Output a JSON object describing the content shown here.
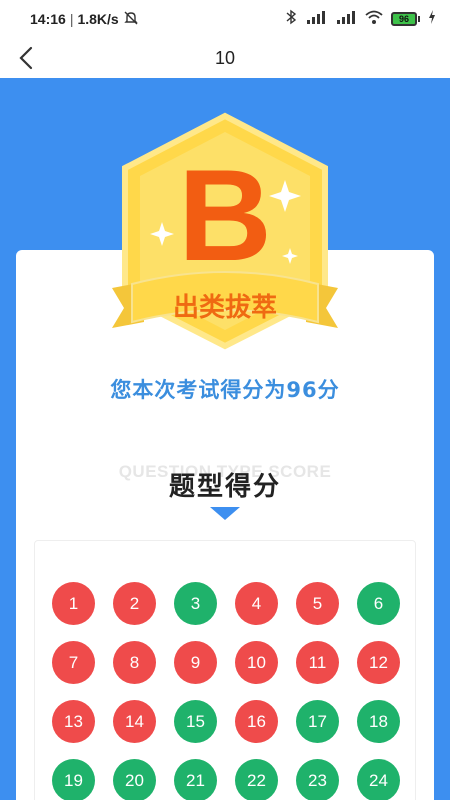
{
  "status_bar": {
    "time": "14:16",
    "net_speed": "1.8K/s",
    "battery": "96"
  },
  "nav": {
    "title": "10"
  },
  "badge": {
    "grade": "B",
    "ribbon_text": "出类拔萃"
  },
  "result": {
    "score_text": "您本次考试得分为96分"
  },
  "section": {
    "title_en": "QUESTION TYPE SCORE",
    "title_cn": "题型得分"
  },
  "colors": {
    "correct": "#1fb26b",
    "wrong": "#ef4b4b",
    "accent": "#3d8ff0"
  },
  "questions": [
    {
      "n": "1",
      "status": "wrong"
    },
    {
      "n": "2",
      "status": "wrong"
    },
    {
      "n": "3",
      "status": "correct"
    },
    {
      "n": "4",
      "status": "wrong"
    },
    {
      "n": "5",
      "status": "wrong"
    },
    {
      "n": "6",
      "status": "correct"
    },
    {
      "n": "7",
      "status": "wrong"
    },
    {
      "n": "8",
      "status": "wrong"
    },
    {
      "n": "9",
      "status": "wrong"
    },
    {
      "n": "10",
      "status": "wrong"
    },
    {
      "n": "11",
      "status": "wrong"
    },
    {
      "n": "12",
      "status": "wrong"
    },
    {
      "n": "13",
      "status": "wrong"
    },
    {
      "n": "14",
      "status": "wrong"
    },
    {
      "n": "15",
      "status": "correct"
    },
    {
      "n": "16",
      "status": "wrong"
    },
    {
      "n": "17",
      "status": "correct"
    },
    {
      "n": "18",
      "status": "correct"
    },
    {
      "n": "19",
      "status": "correct"
    },
    {
      "n": "20",
      "status": "correct"
    },
    {
      "n": "21",
      "status": "correct"
    },
    {
      "n": "22",
      "status": "correct"
    },
    {
      "n": "23",
      "status": "correct"
    },
    {
      "n": "24",
      "status": "correct"
    }
  ]
}
